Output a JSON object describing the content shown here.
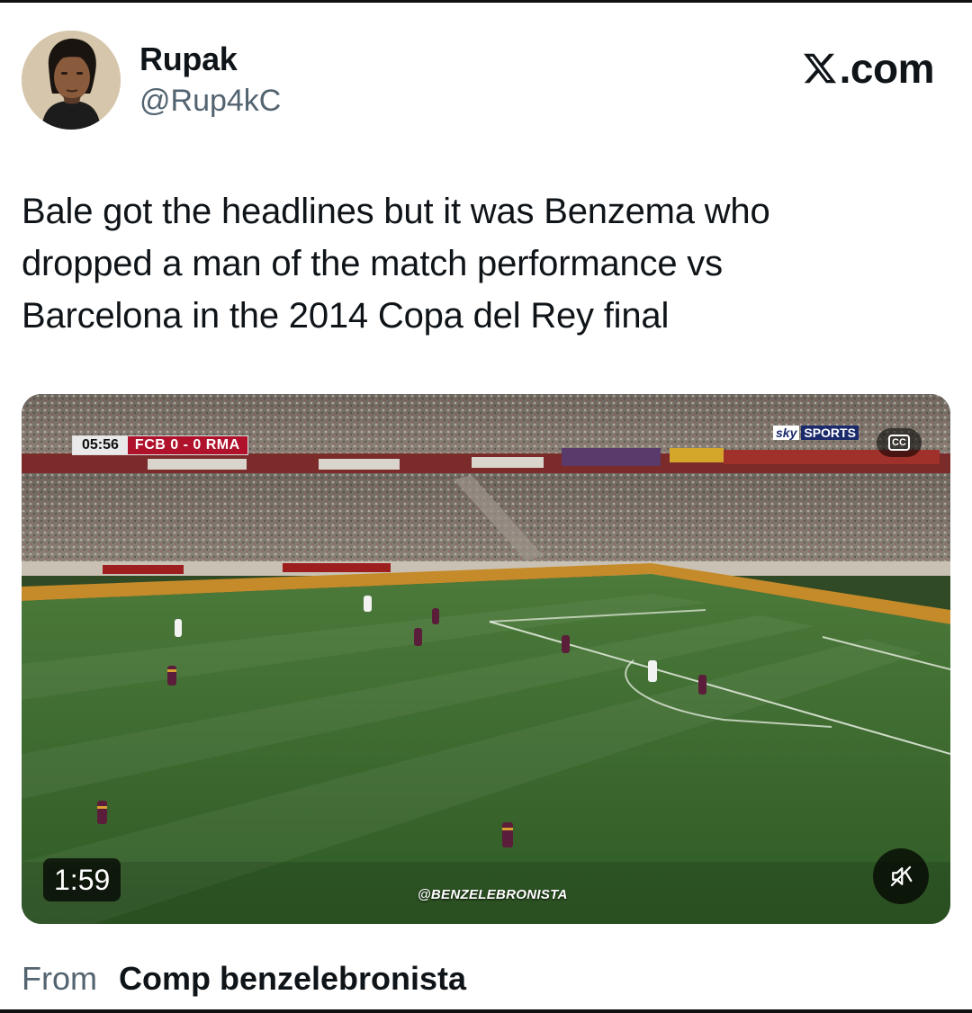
{
  "author": {
    "name": "Rupak",
    "handle": "@Rup4kC"
  },
  "brand": {
    "label": ".com"
  },
  "tweet": {
    "lines": [
      "Bale got the headlines but it was Benzema who",
      "dropped a man of the match performance vs",
      "Barcelona in the 2014 Copa del Rey final"
    ]
  },
  "media": {
    "scorebug": {
      "clock": "05:56",
      "teams": "FCB 0 - 0 RMA"
    },
    "broadcaster": {
      "sky": "sky",
      "sports": "SPORTS"
    },
    "cc_label": "CC",
    "duration": "1:59",
    "watermark": "@BENZELEBRONISTA",
    "mute_icon": "speaker-muted-icon"
  },
  "source": {
    "prefix": "From",
    "name": "Comp benzelebronista"
  },
  "colors": {
    "text_primary": "#0f1419",
    "text_secondary": "#536471",
    "scorebug_red": "#b0122c"
  }
}
